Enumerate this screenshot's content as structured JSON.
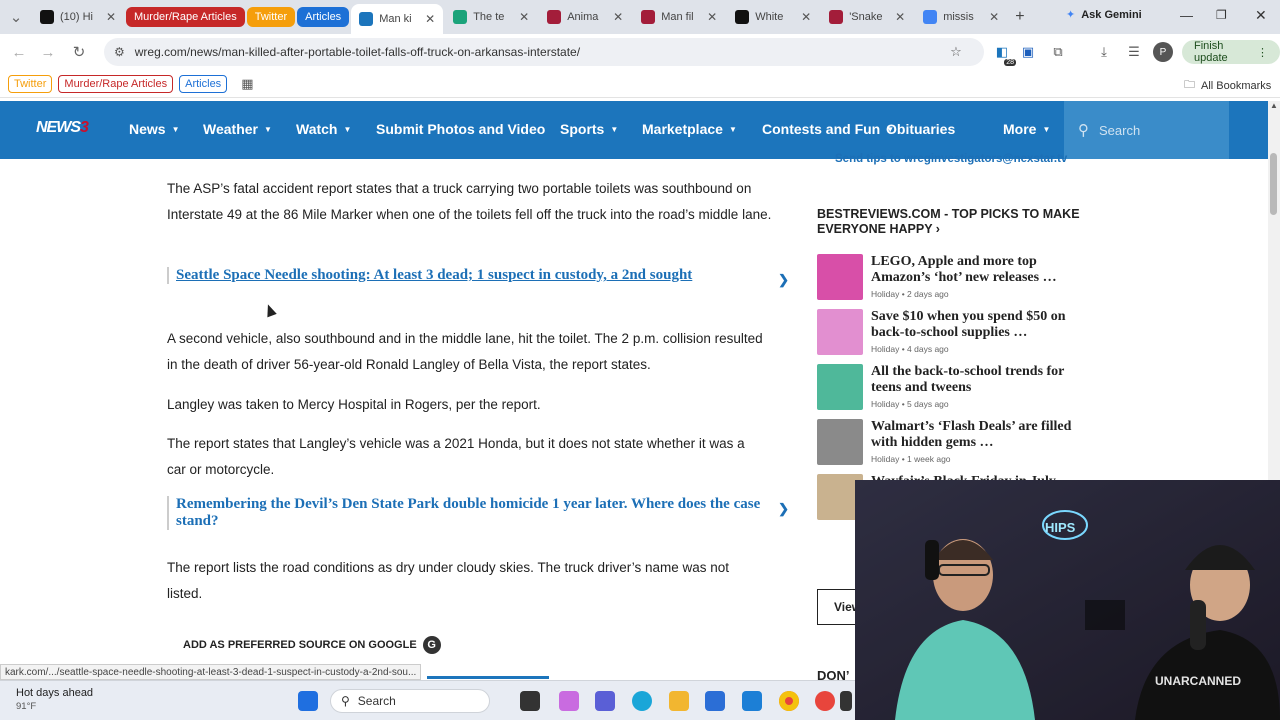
{
  "browser": {
    "tabs": [
      {
        "label": "(10) Hi",
        "color": "#111111"
      },
      {
        "label": "Murder/Rape Articles",
        "pill": true,
        "color": "#c62828"
      },
      {
        "label": "Twitter",
        "pill": true,
        "color": "#f59e0b"
      },
      {
        "label": "Articles",
        "pill": true,
        "color": "#1d70d6"
      },
      {
        "label": "Man ki",
        "active": true,
        "color": "#1c75bc"
      },
      {
        "label": "The te",
        "color": "#1aa37a"
      },
      {
        "label": "Anima",
        "color": "#a31d3a"
      },
      {
        "label": "Man fil",
        "color": "#a31d3a"
      },
      {
        "label": "White",
        "color": "#111111"
      },
      {
        "label": "'Snake",
        "color": "#a31d3a"
      },
      {
        "label": "missis",
        "color": "#4285f4"
      }
    ],
    "new_tab_label": "+",
    "gemini_label": "Ask Gemini",
    "url": "wreg.com/news/man-killed-after-portable-toilet-falls-off-truck-on-arkansas-interstate/",
    "extension_badge": "28",
    "profile_initial": "P",
    "finish_update": "Finish update",
    "bookmarks": [
      {
        "label": "Twitter",
        "color": "#f59e0b"
      },
      {
        "label": "Murder/Rape Articles",
        "color": "#c62828"
      },
      {
        "label": "Articles",
        "color": "#1d70d6"
      }
    ],
    "all_bookmarks": "All Bookmarks",
    "status_url": "kark.com/.../seattle-space-needle-shooting-at-least-3-dead-1-suspect-in-custody-a-2nd-sou..."
  },
  "site": {
    "logo_main": "NEWS",
    "logo_num": "3",
    "nav": [
      {
        "label": "News",
        "caret": true
      },
      {
        "label": "Weather",
        "caret": true
      },
      {
        "label": "Watch",
        "caret": true
      },
      {
        "label": "Submit Photos and Video",
        "caret": false
      },
      {
        "label": "Sports",
        "caret": true
      },
      {
        "label": "Marketplace",
        "caret": true
      },
      {
        "label": "Contests and Fun",
        "caret": true
      },
      {
        "label": "Obituaries",
        "caret": false
      },
      {
        "label": "More",
        "caret": true
      }
    ],
    "search_placeholder": "Search"
  },
  "article": {
    "para1": "The ASP’s fatal accident report states that a truck carrying two portable toilets was southbound on Interstate 49 at the 86 Mile Marker when one of the toilets fell off the truck into the road’s middle lane.",
    "related1": "Seattle Space Needle shooting: At least 3 dead; 1 suspect in custody, a 2nd sought",
    "para2": "A second vehicle, also southbound and in the middle lane, hit the toilet. The 2 p.m. collision resulted in the death of driver 56-year-old Ronald Langley of Bella Vista, the report states.",
    "para3": "Langley was taken to Mercy Hospital in Rogers, per the report.",
    "para4": "The report states that Langley’s vehicle was a 2021 Honda, but it does not state whether it was a car or motorcycle.",
    "related2": "Remembering the Devil’s Den State Park double homicide 1 year later. Where does the case stand?",
    "para5": "The report lists the road conditions as dry under cloudy skies. The truck driver’s name was not listed.",
    "preferred_source": "ADD AS PREFERRED SOURCE ON GOOGLE"
  },
  "sidebar": {
    "tip_text": "Send tips to wreginvestigators@nexstar.tv",
    "heading": "BESTREVIEWS.COM - TOP PICKS TO MAKE EVERYONE HAPPY ›",
    "cards": [
      {
        "title": "LEGO, Apple and more top Amazon’s ‘hot’ new releases …",
        "meta": "Holiday • 2 days ago",
        "color": "#d84fa8"
      },
      {
        "title": "Save $10 when you spend $50 on back-to-school supplies …",
        "meta": "Holiday • 4 days ago",
        "color": "#e28fd0"
      },
      {
        "title": "All the back-to-school trends for teens and tweens",
        "meta": "Holiday • 5 days ago",
        "color": "#4fb89a"
      },
      {
        "title": "Walmart’s ‘Flash Deals’ are filled with hidden gems …",
        "meta": "Holiday • 1 week ago",
        "color": "#8a8a8a"
      },
      {
        "title": "Wayfair’s Black Friday in July",
        "meta": "",
        "color": "#c9b28f"
      }
    ],
    "view_label": "View",
    "dont_label": "DON’"
  },
  "webcam": {
    "neon_text": "HIPS",
    "shirt_text": "UNARCANNED"
  },
  "taskbar": {
    "weather_title": "Hot days ahead",
    "weather_temp": "91°F",
    "search_label": "Search"
  }
}
